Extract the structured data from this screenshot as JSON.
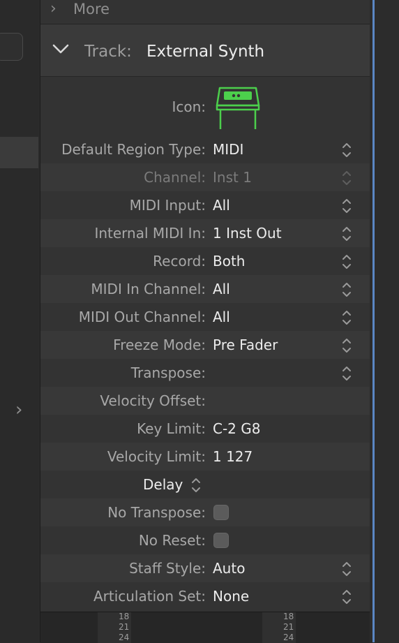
{
  "more_section": {
    "label": "More"
  },
  "track_header": {
    "prefix": "Track:",
    "name": "External Synth"
  },
  "icon_row": {
    "label": "Icon:"
  },
  "colors": {
    "accent_icon": "#4ccf4c",
    "selection_blue": "#5a86c4"
  },
  "rows": [
    {
      "label": "Default Region Type:",
      "value": "MIDI",
      "control": "stepper"
    },
    {
      "label": "Channel:",
      "value": "Inst 1",
      "control": "stepper",
      "disabled": true
    },
    {
      "label": "MIDI Input:",
      "value": "All",
      "control": "stepper"
    },
    {
      "label": "Internal MIDI In:",
      "value": "1 Inst Out",
      "control": "stepper"
    },
    {
      "label": "Record:",
      "value": "Both",
      "control": "stepper"
    },
    {
      "label": "MIDI In Channel:",
      "value": "All",
      "control": "stepper"
    },
    {
      "label": "MIDI Out Channel:",
      "value": "All",
      "control": "stepper"
    },
    {
      "label": "Freeze Mode:",
      "value": "Pre Fader",
      "control": "stepper"
    },
    {
      "label": "Transpose:",
      "value": "",
      "control": "stepper"
    },
    {
      "label": "Velocity Offset:",
      "value": "",
      "control": "none"
    },
    {
      "label": "Key Limit:",
      "value": "C-2  G8",
      "control": "none"
    },
    {
      "label": "Velocity Limit:",
      "value": "1  127",
      "control": "none"
    },
    {
      "label": "Delay",
      "value": "",
      "control": "stepper",
      "delay": true
    },
    {
      "label": "No Transpose:",
      "value": "",
      "control": "checkbox",
      "checked": false
    },
    {
      "label": "No Reset:",
      "value": "",
      "control": "checkbox",
      "checked": false
    },
    {
      "label": "Staff Style:",
      "value": "Auto",
      "control": "stepper"
    },
    {
      "label": "Articulation Set:",
      "value": "None",
      "control": "stepper"
    }
  ],
  "mixer_ticks": [
    "18",
    "21",
    "24"
  ]
}
